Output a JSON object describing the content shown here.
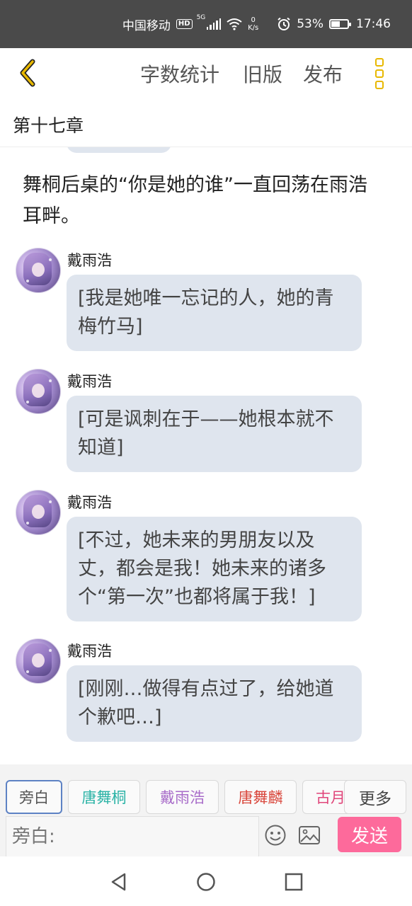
{
  "status_bar": {
    "carrier": "中国移动",
    "hd": "HD",
    "network": "5G",
    "net_speed_value": "0",
    "net_speed_unit": "K/s",
    "battery": "53%",
    "battery_level": 0.53,
    "time": "17:46"
  },
  "toolbar": {
    "word_count": "字数统计",
    "old_version": "旧版",
    "publish": "发布"
  },
  "chapter": {
    "title": "第十七章"
  },
  "narration": "舞桐后桌的“你是她的谁”一直回荡在雨浩耳畔。",
  "messages": [
    {
      "sender": "戴雨浩",
      "text": "[我是她唯一忘记的人，她的青梅竹马]"
    },
    {
      "sender": "戴雨浩",
      "text": "[可是讽刺在于——她根本就不知道]"
    },
    {
      "sender": "戴雨浩",
      "text": "[不过，她未来的男朋友以及丈，都会是我！她未来的诸多个“第一次”也都将属于我！]"
    },
    {
      "sender": "戴雨浩",
      "text": "[刚刚…做得有点过了，给她道个歉吧…]"
    }
  ],
  "roles": [
    {
      "label": "旁白",
      "color": "#555555"
    },
    {
      "label": "唐舞桐",
      "color": "#2bb3a6"
    },
    {
      "label": "戴雨浩",
      "color": "#a86cc9"
    },
    {
      "label": "唐舞麟",
      "color": "#d9473c"
    },
    {
      "label": "古月",
      "color": "#e0457a"
    }
  ],
  "more_label": "更多",
  "input": {
    "placeholder": "旁白:"
  },
  "send_label": "发送",
  "colors": {
    "accent": "#e8b800",
    "send": "#fd6a9b",
    "bubble": "#dfe5ee",
    "active_tab_border": "#5d82c4"
  },
  "icons": {
    "back": "chevron-left-icon",
    "menu": "more-vertical-icon",
    "emoji": "smiley-icon",
    "image": "image-icon",
    "nav_back": "triangle-back-icon",
    "nav_home": "circle-home-icon",
    "nav_recent": "square-recents-icon"
  }
}
